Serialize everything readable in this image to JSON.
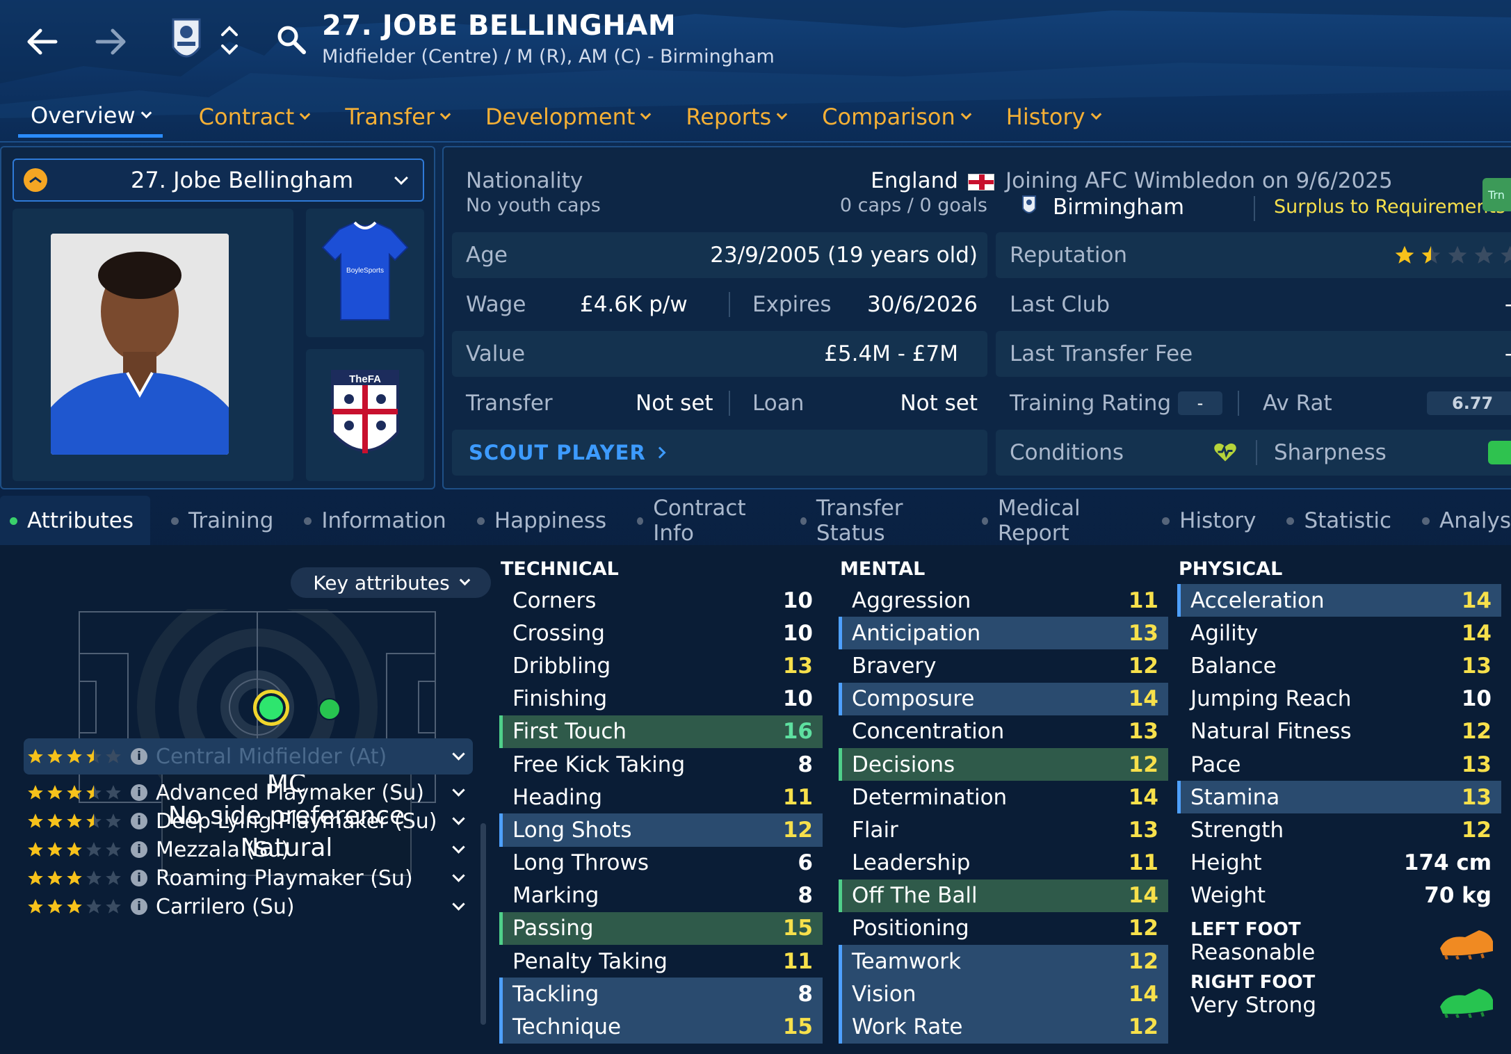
{
  "header": {
    "title": "27. JOBE BELLINGHAM",
    "subtitle": "Midfielder (Centre) / M (R), AM (C) - Birmingham",
    "icons": [
      "back-arrow-icon",
      "forward-arrow-icon",
      "club-crest-icon",
      "up-down-chevron-icon",
      "search-icon"
    ]
  },
  "nav": {
    "tabs": [
      {
        "label": "Overview",
        "active": true
      },
      {
        "label": "Contract"
      },
      {
        "label": "Transfer"
      },
      {
        "label": "Development"
      },
      {
        "label": "Reports"
      },
      {
        "label": "Comparison"
      },
      {
        "label": "History"
      }
    ]
  },
  "player_card": {
    "select_label": "27. Jobe Bellingham",
    "kit_text": "BoyleSports",
    "badge_text": "TheFA"
  },
  "info": {
    "nationality_label": "Nationality",
    "nationality": "England",
    "youth_caps_label": "No youth caps",
    "caps_goals": "0 caps / 0 goals",
    "joining": "Joining AFC Wimbledon on 9/6/2025",
    "club": "Birmingham",
    "status": "Surplus to Requirements",
    "edge_tag": "Trn",
    "age_label": "Age",
    "age": "23/9/2005 (19 years old)",
    "reputation_label": "Reputation",
    "reputation_stars": 1.5,
    "wage_label": "Wage",
    "wage": "£4.6K p/w",
    "expires_label": "Expires",
    "expires": "30/6/2026",
    "last_club_label": "Last Club",
    "last_club": "-",
    "value_label": "Value",
    "value": "£5.4M - £7M",
    "last_fee_label": "Last Transfer Fee",
    "last_fee": "-",
    "transfer_label": "Transfer",
    "transfer": "Not set",
    "loan_label": "Loan",
    "loan": "Not set",
    "training_label": "Training Rating",
    "training": "-",
    "avrat_label": "Av Rat",
    "avrat": "6.77",
    "scout_label": "SCOUT PLAYER",
    "conditions_label": "Conditions",
    "sharpness_label": "Sharpness"
  },
  "subtabs": [
    {
      "label": "Attributes",
      "active": true
    },
    {
      "label": "Training"
    },
    {
      "label": "Information"
    },
    {
      "label": "Happiness"
    },
    {
      "label": "Contract Info"
    },
    {
      "label": "Transfer Status"
    },
    {
      "label": "Medical Report"
    },
    {
      "label": "History"
    },
    {
      "label": "Statistic"
    },
    {
      "label": "Analys"
    }
  ],
  "position_panel": {
    "key_attributes": "Key attributes",
    "tooltip_line1": "MC",
    "tooltip_line2": "No side preference",
    "tooltip_line3": "Natural",
    "roles": [
      {
        "name": "Central Midfielder (At)",
        "stars": 3.5
      },
      {
        "name": "Advanced Playmaker (Su)",
        "stars": 3.5
      },
      {
        "name": "Deep Lying Playmaker (Su)",
        "stars": 3.5
      },
      {
        "name": "Mezzala (Su)",
        "stars": 3
      },
      {
        "name": "Roaming Playmaker (Su)",
        "stars": 3
      },
      {
        "name": "Carrilero (Su)",
        "stars": 3
      }
    ]
  },
  "technical": {
    "title": "TECHNICAL",
    "attrs": [
      {
        "name": "Corners",
        "value": "10",
        "hl": ""
      },
      {
        "name": "Crossing",
        "value": "10",
        "hl": ""
      },
      {
        "name": "Dribbling",
        "value": "13",
        "hl": ""
      },
      {
        "name": "Finishing",
        "value": "10",
        "hl": ""
      },
      {
        "name": "First Touch",
        "value": "16",
        "hl": "green"
      },
      {
        "name": "Free Kick Taking",
        "value": "8",
        "hl": ""
      },
      {
        "name": "Heading",
        "value": "11",
        "hl": ""
      },
      {
        "name": "Long Shots",
        "value": "12",
        "hl": "blue"
      },
      {
        "name": "Long Throws",
        "value": "6",
        "hl": ""
      },
      {
        "name": "Marking",
        "value": "8",
        "hl": ""
      },
      {
        "name": "Passing",
        "value": "15",
        "hl": "green"
      },
      {
        "name": "Penalty Taking",
        "value": "11",
        "hl": ""
      },
      {
        "name": "Tackling",
        "value": "8",
        "hl": "blue"
      },
      {
        "name": "Technique",
        "value": "15",
        "hl": "blue"
      }
    ]
  },
  "mental": {
    "title": "MENTAL",
    "attrs": [
      {
        "name": "Aggression",
        "value": "11",
        "hl": ""
      },
      {
        "name": "Anticipation",
        "value": "13",
        "hl": "blue"
      },
      {
        "name": "Bravery",
        "value": "12",
        "hl": ""
      },
      {
        "name": "Composure",
        "value": "14",
        "hl": "blue"
      },
      {
        "name": "Concentration",
        "value": "13",
        "hl": ""
      },
      {
        "name": "Decisions",
        "value": "12",
        "hl": "green"
      },
      {
        "name": "Determination",
        "value": "14",
        "hl": ""
      },
      {
        "name": "Flair",
        "value": "13",
        "hl": ""
      },
      {
        "name": "Leadership",
        "value": "11",
        "hl": ""
      },
      {
        "name": "Off The Ball",
        "value": "14",
        "hl": "green"
      },
      {
        "name": "Positioning",
        "value": "12",
        "hl": ""
      },
      {
        "name": "Teamwork",
        "value": "12",
        "hl": "blue"
      },
      {
        "name": "Vision",
        "value": "14",
        "hl": "blue"
      },
      {
        "name": "Work Rate",
        "value": "12",
        "hl": "blue"
      }
    ]
  },
  "physical": {
    "title": "PHYSICAL",
    "attrs": [
      {
        "name": "Acceleration",
        "value": "14",
        "hl": "blue"
      },
      {
        "name": "Agility",
        "value": "14",
        "hl": ""
      },
      {
        "name": "Balance",
        "value": "13",
        "hl": ""
      },
      {
        "name": "Jumping Reach",
        "value": "10",
        "hl": ""
      },
      {
        "name": "Natural Fitness",
        "value": "12",
        "hl": ""
      },
      {
        "name": "Pace",
        "value": "13",
        "hl": ""
      },
      {
        "name": "Stamina",
        "value": "13",
        "hl": "blue"
      },
      {
        "name": "Strength",
        "value": "12",
        "hl": ""
      },
      {
        "name": "Height",
        "value": "174 cm",
        "hl": ""
      },
      {
        "name": "Weight",
        "value": "70 kg",
        "hl": ""
      }
    ],
    "left_foot_label": "LEFT FOOT",
    "left_foot": "Reasonable",
    "right_foot_label": "RIGHT FOOT",
    "right_foot": "Very Strong"
  },
  "colors": {
    "accent": "#2b8cff",
    "nav_text": "#f5b036",
    "value_yellow": "#f7e04b",
    "value_green": "#5ee0a0",
    "highlight_blue": "#2a4b6f",
    "highlight_green": "#2f5a4a"
  }
}
